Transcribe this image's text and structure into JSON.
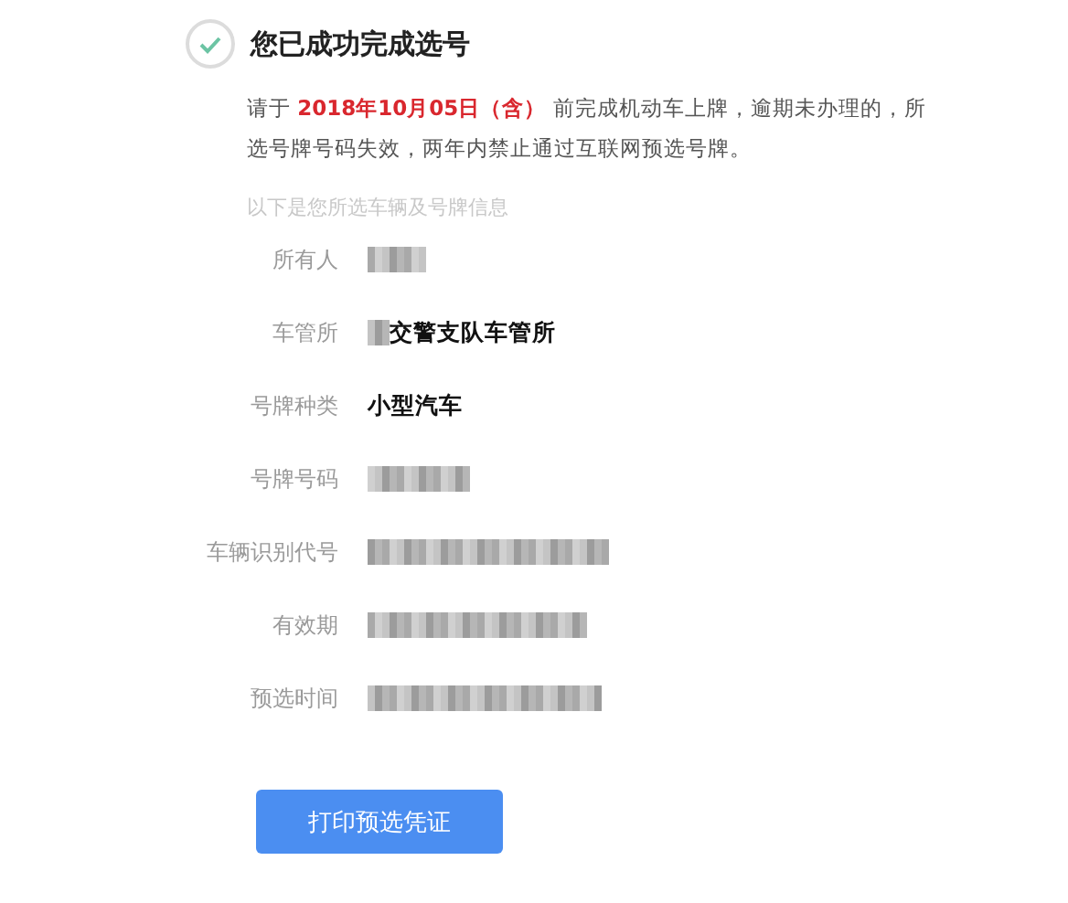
{
  "title": "您已成功完成选号",
  "notice": "请于 **2018年10月05日（含）** 前完成机动车上牌，逾期未办理的，所选号牌号码失效，两年内禁止通过互联网预选号牌。",
  "section_heading": "以下是您所选车辆及号牌信息",
  "fields": [
    {
      "label": "所有人",
      "redacted": true
    },
    {
      "label": "车管所",
      "redacted": true,
      "value": "交警支队车管所"
    },
    {
      "label": "号牌种类",
      "value": "小型汽车"
    },
    {
      "label": "号牌号码",
      "redacted": true
    },
    {
      "label": "车辆识别代号",
      "redacted": true
    },
    {
      "label": "有效期",
      "redacted": true
    },
    {
      "label": "预选时间",
      "redacted": true
    }
  ],
  "print_button": "打印预选凭证"
}
